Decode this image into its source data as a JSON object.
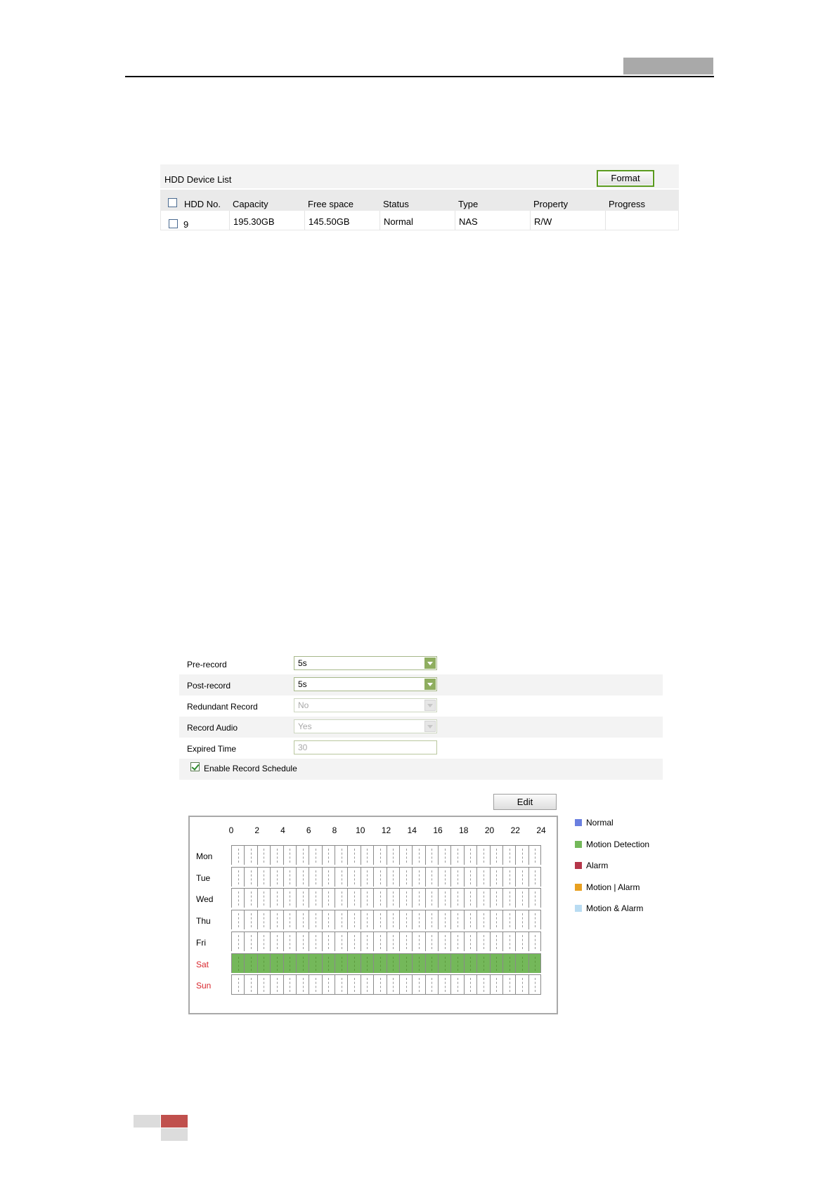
{
  "hdd": {
    "title": "HDD Device List",
    "format_label": "Format",
    "headers": [
      "HDD No.",
      "Capacity",
      "Free space",
      "Status",
      "Type",
      "Property",
      "Progress"
    ],
    "row": {
      "no": "9",
      "capacity": "195.30GB",
      "free": "145.50GB",
      "status": "Normal",
      "type": "NAS",
      "property": "R/W",
      "progress": ""
    }
  },
  "record": {
    "pre_record": {
      "label": "Pre-record",
      "value": "5s"
    },
    "post_record": {
      "label": "Post-record",
      "value": "5s"
    },
    "redundant": {
      "label": "Redundant Record",
      "value": "No"
    },
    "audio": {
      "label": "Record Audio",
      "value": "Yes"
    },
    "expired": {
      "label": "Expired Time",
      "value": "30"
    },
    "enable_schedule": {
      "label": "Enable Record Schedule",
      "checked": true
    },
    "edit_label": "Edit"
  },
  "schedule": {
    "hours": [
      "0",
      "2",
      "4",
      "6",
      "8",
      "10",
      "12",
      "14",
      "16",
      "18",
      "20",
      "22",
      "24"
    ],
    "days": [
      {
        "label": "Mon",
        "weekend": false,
        "mode": ""
      },
      {
        "label": "Tue",
        "weekend": false,
        "mode": ""
      },
      {
        "label": "Wed",
        "weekend": false,
        "mode": ""
      },
      {
        "label": "Thu",
        "weekend": false,
        "mode": ""
      },
      {
        "label": "Fri",
        "weekend": false,
        "mode": ""
      },
      {
        "label": "Sat",
        "weekend": true,
        "mode": "Motion Detection"
      },
      {
        "label": "Sun",
        "weekend": true,
        "mode": ""
      }
    ],
    "legend": [
      {
        "label": "Normal",
        "color": "#6a7fe0"
      },
      {
        "label": "Motion Detection",
        "color": "#74b85a"
      },
      {
        "label": "Alarm",
        "color": "#b5364a"
      },
      {
        "label": "Motion | Alarm",
        "color": "#e8a020"
      },
      {
        "label": "Motion & Alarm",
        "color": "#b9dcf2"
      }
    ]
  }
}
